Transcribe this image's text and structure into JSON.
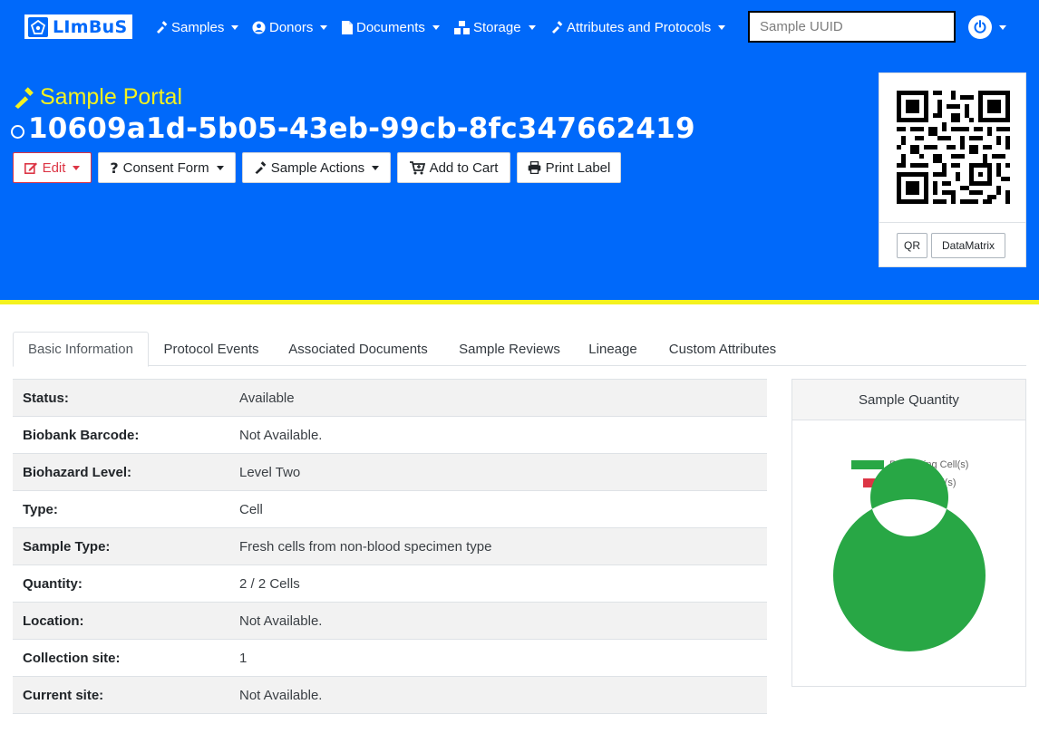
{
  "navbar": {
    "brand": "LImBuS",
    "items": [
      {
        "label": "Samples",
        "icon": "pipette-icon"
      },
      {
        "label": "Donors",
        "icon": "user-circle-icon"
      },
      {
        "label": "Documents",
        "icon": "file-icon"
      },
      {
        "label": "Storage",
        "icon": "boxes-icon"
      },
      {
        "label": "Attributes and Protocols",
        "icon": "pipette-icon"
      }
    ],
    "search_placeholder": "Sample UUID",
    "user_icon": "power-icon"
  },
  "header": {
    "portal_title": "Sample Portal",
    "uuid": "10609a1d-5b05-43eb-99cb-8fc347662419",
    "buttons": {
      "edit": "Edit",
      "consent": "Consent Form",
      "actions": "Sample Actions",
      "cart": "Add to Cart",
      "print": "Print Label"
    },
    "code_buttons": {
      "qr": "QR",
      "datamatrix": "DataMatrix"
    }
  },
  "tabs": [
    "Basic Information",
    "Protocol Events",
    "Associated Documents",
    "Sample Reviews",
    "Lineage",
    "Custom Attributes"
  ],
  "active_tab": "Basic Information",
  "info": [
    {
      "key": "Status:",
      "value": "Available"
    },
    {
      "key": "Biobank Barcode:",
      "value": "Not Available."
    },
    {
      "key": "Biohazard Level:",
      "value": "Level Two"
    },
    {
      "key": "Type:",
      "value": "Cell"
    },
    {
      "key": "Sample Type:",
      "value": "Fresh cells from non-blood specimen type"
    },
    {
      "key": "Quantity:",
      "value": "2 / 2 Cells"
    },
    {
      "key": "Location:",
      "value": "Not Available."
    },
    {
      "key": "Collection site:",
      "value": "1"
    },
    {
      "key": "Current site:",
      "value": "Not Available."
    }
  ],
  "colors": {
    "primary": "#0069fa",
    "accent_yellow": "#f4f21f",
    "remaining": "#28a745",
    "used": "#dc3545",
    "edit_red": "#dc3545"
  },
  "chart_data": {
    "type": "pie",
    "title": "Sample Quantity",
    "legend_position": "top",
    "categories": [
      "Remaining Cell(s)",
      "Used Cell(s)"
    ],
    "values": [
      2,
      0
    ],
    "colors": [
      "#28a745",
      "#dc3545"
    ]
  }
}
